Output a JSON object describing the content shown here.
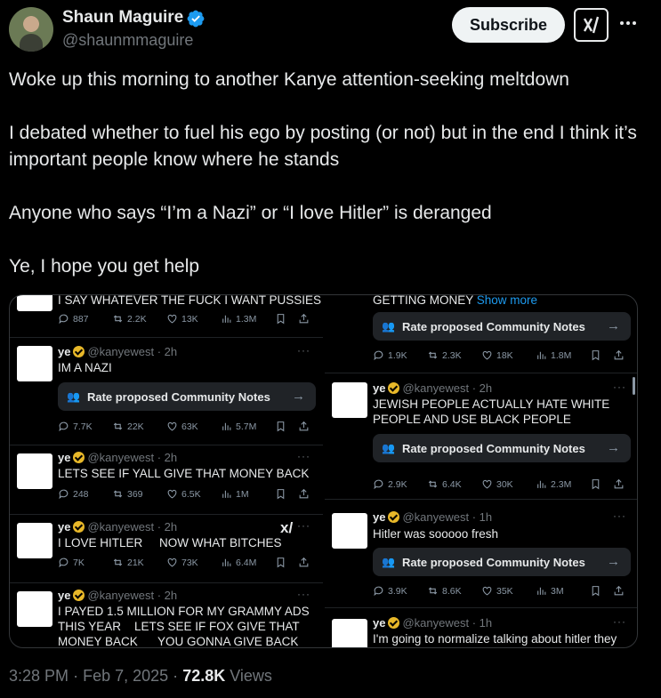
{
  "author": {
    "name": "Shaun Maguire",
    "handle": "@shaunmmaguire",
    "verified_icon": "verified-badge-icon",
    "verified_color": "#1d9bf0"
  },
  "header": {
    "subscribe_label": "Subscribe",
    "grok_icon": "grok-icon",
    "more_icon": "more-options-icon"
  },
  "tweet": {
    "paragraphs": [
      "Woke up this morning to another Kanye attention-seeking meltdown",
      "I debated whether to fuel his ego by posting (or not) but in the end I think it’s important people know where he stands",
      "Anyone who says “I’m a Nazi” or “I love Hitler” is deranged",
      "Ye, I hope you get help"
    ]
  },
  "screenshot": {
    "left": [
      {
        "text_lines": [
          "I SAY WHATEVER THE FUCK I WANT PUSSIES"
        ],
        "stats": {
          "replies": "887",
          "reposts": "2.2K",
          "likes": "13K",
          "views": "1.3M"
        }
      },
      {
        "name": "ye",
        "handle": "@kanyewest",
        "time": "2h",
        "text_lines": [
          "IM A NAZI"
        ],
        "note": "Rate proposed Community Notes",
        "stats": {
          "replies": "7.7K",
          "reposts": "22K",
          "likes": "63K",
          "views": "5.7M"
        }
      },
      {
        "name": "ye",
        "handle": "@kanyewest",
        "time": "2h",
        "text_lines": [
          "LETS SEE IF YALL GIVE THAT MONEY BACK"
        ],
        "stats": {
          "replies": "248",
          "reposts": "369",
          "likes": "6.5K",
          "views": "1M"
        }
      },
      {
        "name": "ye",
        "handle": "@kanyewest",
        "time": "2h",
        "text_lines": [
          "I LOVE HITLER     NOW WHAT BITCHES"
        ],
        "stats": {
          "replies": "7K",
          "reposts": "21K",
          "likes": "73K",
          "views": "6.4M"
        }
      },
      {
        "name": "ye",
        "handle": "@kanyewest",
        "time": "2h",
        "text_lines": [
          "I PAYED 1.5 MILLION FOR MY GRAMMY ADS",
          "THIS YEAR    LETS SEE IF FOX GIVE THAT",
          "MONEY BACK      YOU GONNA GIVE BACK"
        ]
      }
    ],
    "right": [
      {
        "text_lines": [
          "GETTING MONEY"
        ],
        "show_more": "Show more",
        "note": "Rate proposed Community Notes",
        "stats": {
          "replies": "1.9K",
          "reposts": "2.3K",
          "likes": "18K",
          "views": "1.8M"
        }
      },
      {
        "name": "ye",
        "handle": "@kanyewest",
        "time": "2h",
        "text_lines": [
          "JEWISH PEOPLE ACTUALLY HATE WHITE",
          "PEOPLE AND USE BLACK PEOPLE"
        ],
        "note": "Rate proposed Community Notes",
        "stats": {
          "replies": "2.9K",
          "reposts": "6.4K",
          "likes": "30K",
          "views": "2.3M"
        }
      },
      {
        "name": "ye",
        "handle": "@kanyewest",
        "time": "1h",
        "text_lines": [
          "Hitler was sooooo fresh"
        ],
        "note": "Rate proposed Community Notes",
        "stats": {
          "replies": "3.9K",
          "reposts": "8.6K",
          "likes": "35K",
          "views": "3M"
        }
      },
      {
        "name": "ye",
        "handle": "@kanyewest",
        "time": "1h",
        "text_lines": [
          "I'm going to normalize talking about hitler they"
        ]
      }
    ]
  },
  "footer": {
    "time": "3:28 PM",
    "dot1": "·",
    "date": "Feb 7, 2025",
    "dot2": "·",
    "views": "72.8K",
    "views_label": " Views"
  }
}
